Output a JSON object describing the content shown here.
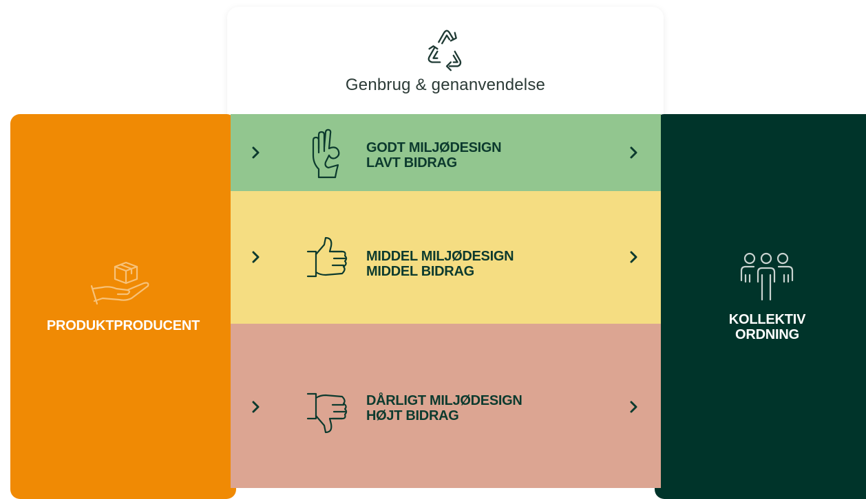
{
  "top_card": {
    "title": "Genbrug & genanvendelse",
    "icon": "recycle-icon"
  },
  "producer": {
    "label": "PRODUKTPRODUCENT",
    "icon": "hand-with-box-icon",
    "color": "#f08a04"
  },
  "collective": {
    "line1": "KOLLEKTIV",
    "line2": "ORDNING",
    "icon": "people-group-icon",
    "color": "#00342a"
  },
  "bands": [
    {
      "line1": "GODT MILJØDESIGN",
      "line2": "LAVT BIDRAG",
      "icon": "ok-hand-icon",
      "color": "#92c68f"
    },
    {
      "line1": "MIDDEL MILJØDESIGN",
      "line2": "MIDDEL BIDRAG",
      "icon": "thumbs-up-icon",
      "color": "#f5dd82"
    },
    {
      "line1": "DÅRLIGT MILJØDESIGN",
      "line2": "HØJT BIDRAG",
      "icon": "thumbs-down-icon",
      "color": "#dca592"
    }
  ],
  "text_color": "#0c3a2e"
}
